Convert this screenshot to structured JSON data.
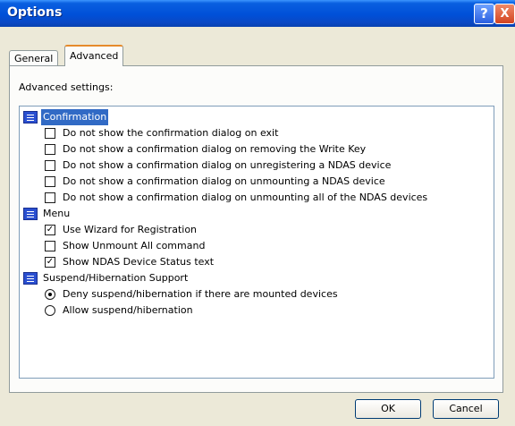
{
  "window": {
    "title": "Options",
    "help_label": "?",
    "close_label": "X"
  },
  "tabs": [
    {
      "label": "General",
      "active": false
    },
    {
      "label": "Advanced",
      "active": true
    }
  ],
  "panel": {
    "label": "Advanced settings:"
  },
  "groups": [
    {
      "label": "Confirmation",
      "selected": true,
      "items": [
        {
          "type": "checkbox",
          "label": "Do not show the confirmation dialog on exit",
          "checked": false
        },
        {
          "type": "checkbox",
          "label": "Do not show a confirmation dialog on removing the Write Key",
          "checked": false
        },
        {
          "type": "checkbox",
          "label": "Do not show a confirmation dialog on unregistering a NDAS device",
          "checked": false
        },
        {
          "type": "checkbox",
          "label": "Do not show a confirmation dialog on unmounting a NDAS device",
          "checked": false
        },
        {
          "type": "checkbox",
          "label": "Do not show a confirmation dialog on unmounting all of the NDAS devices",
          "checked": false
        }
      ]
    },
    {
      "label": "Menu",
      "selected": false,
      "items": [
        {
          "type": "checkbox",
          "label": "Use Wizard for Registration",
          "checked": true
        },
        {
          "type": "checkbox",
          "label": "Show Unmount All command",
          "checked": false
        },
        {
          "type": "checkbox",
          "label": "Show NDAS Device Status text",
          "checked": true
        }
      ]
    },
    {
      "label": "Suspend/Hibernation Support",
      "selected": false,
      "items": [
        {
          "type": "radio",
          "label": "Deny suspend/hibernation if there are mounted devices",
          "checked": true
        },
        {
          "type": "radio",
          "label": "Allow suspend/hibernation",
          "checked": false
        }
      ]
    }
  ],
  "buttons": {
    "ok": "OK",
    "cancel": "Cancel"
  },
  "colors": {
    "title_bar": "#0a5fe0",
    "selection": "#316ac5",
    "dialog_bg": "#ece9d8"
  }
}
